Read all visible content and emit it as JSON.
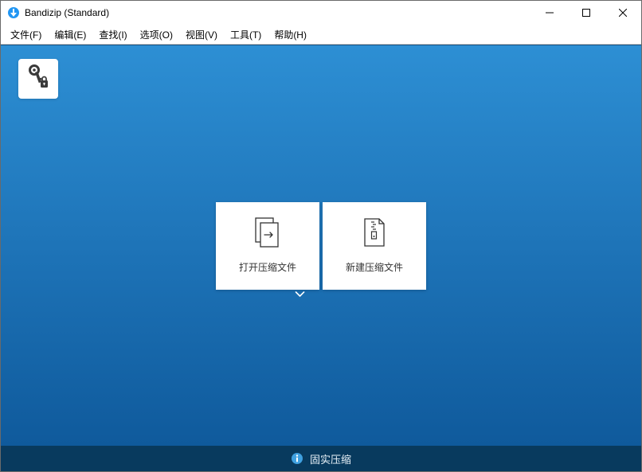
{
  "title": "Bandizip (Standard)",
  "menu": {
    "file": "文件(F)",
    "edit": "编辑(E)",
    "find": "查找(I)",
    "options": "选项(O)",
    "view": "视图(V)",
    "tools": "工具(T)",
    "help": "帮助(H)"
  },
  "actions": {
    "open_archive": "打开压缩文件",
    "new_archive": "新建压缩文件"
  },
  "status": {
    "solid_compression": "固实压缩"
  },
  "icons": {
    "app": "app-icon",
    "keylock": "key-lock-icon",
    "open": "file-open-icon",
    "new": "zip-new-icon",
    "chevron": "chevron-down-icon",
    "info": "info-icon"
  },
  "colors": {
    "gradient_top": "#2d8fd4",
    "gradient_bottom": "#0f5a9c",
    "status_bg": "#083a5e"
  }
}
